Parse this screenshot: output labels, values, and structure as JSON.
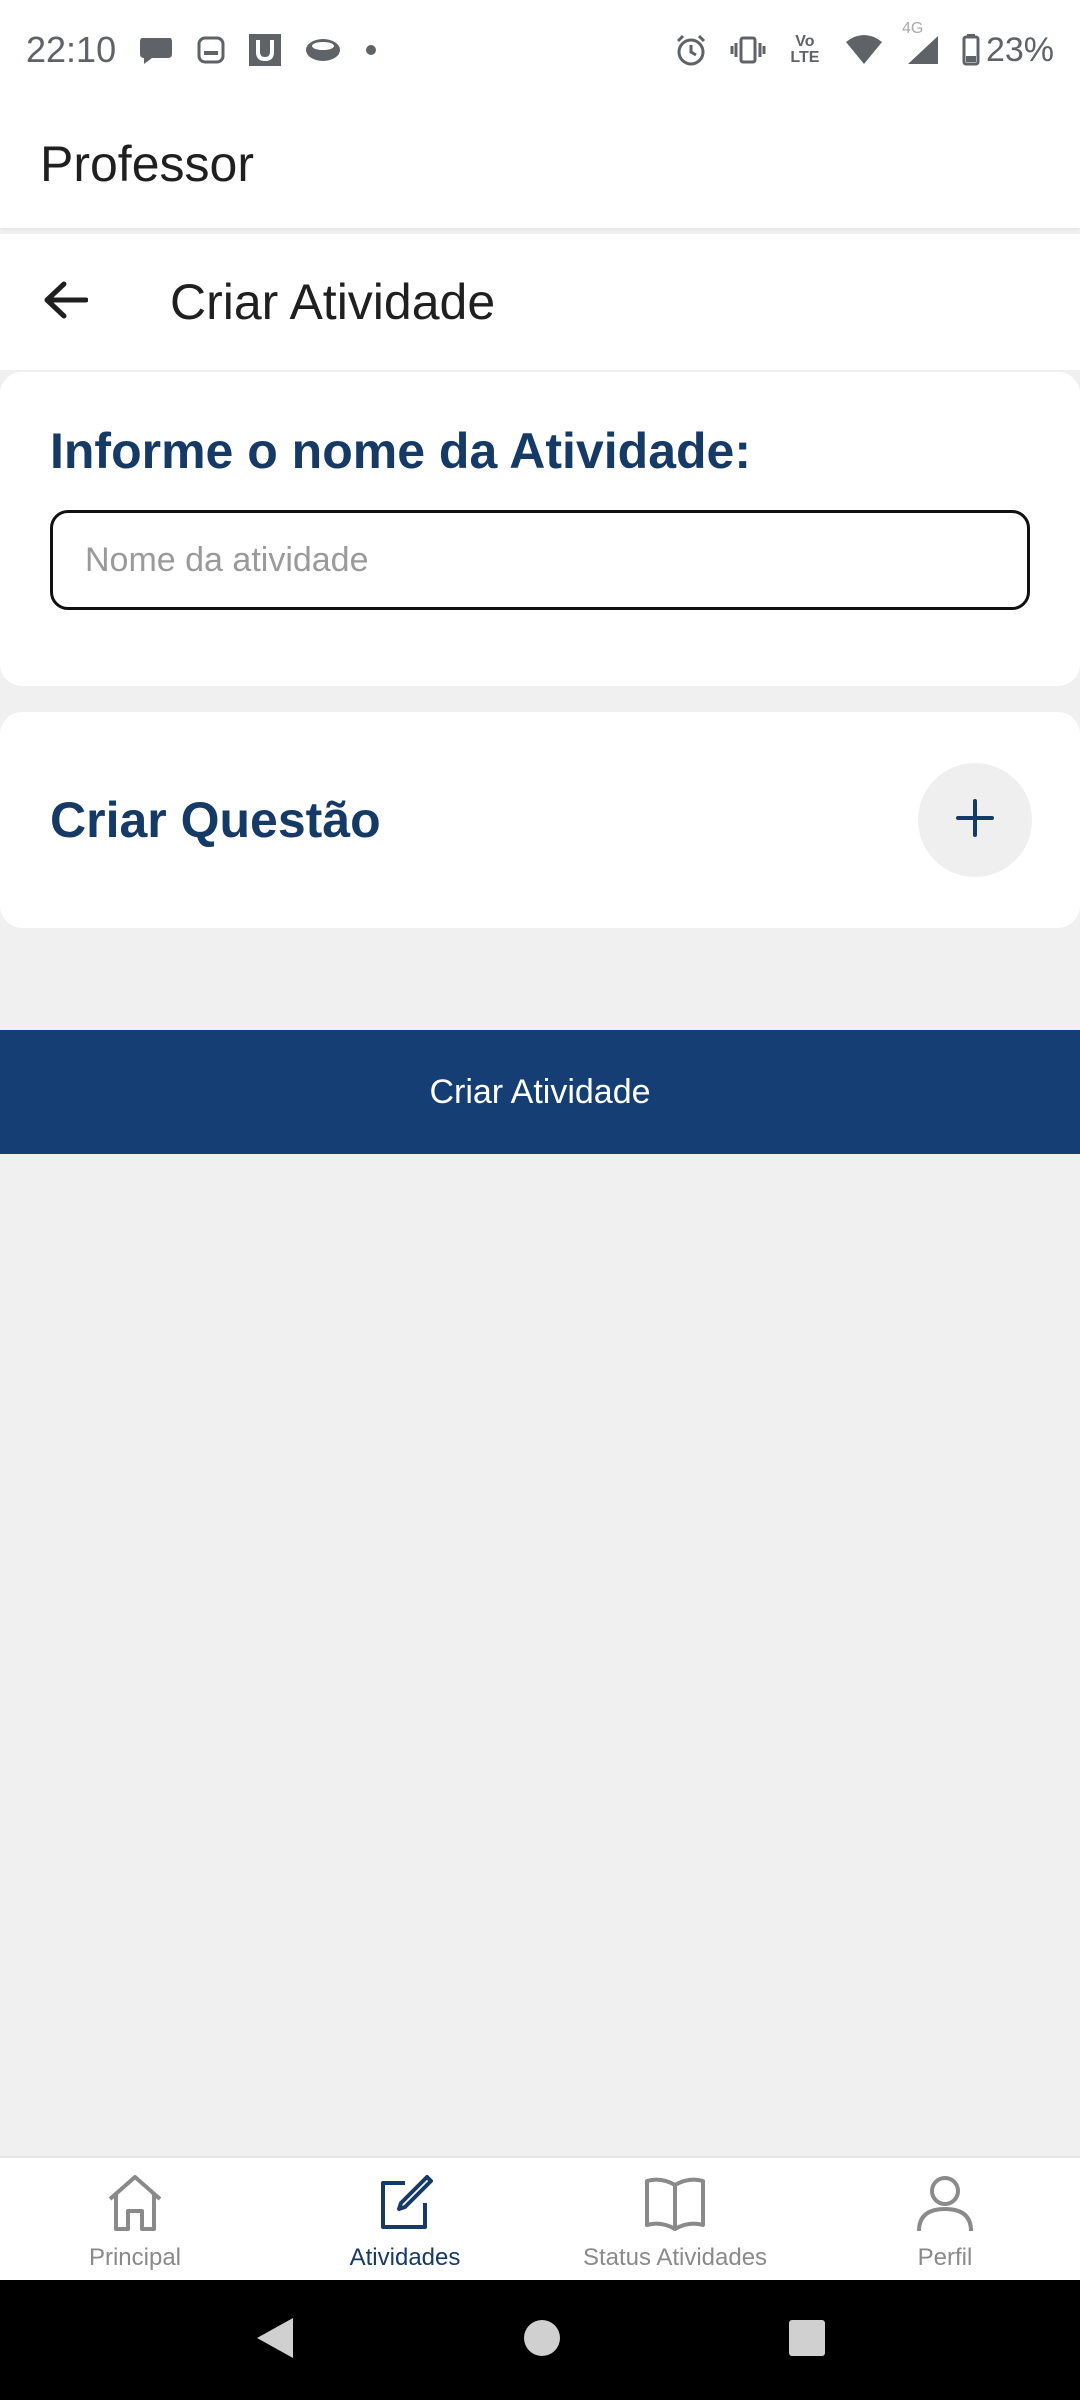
{
  "status_bar": {
    "time": "22:10",
    "left_icons": [
      "chat-bubble-icon",
      "message-square-icon",
      "u-app-icon",
      "eye-app-icon",
      "dot-icon"
    ],
    "right_icons": [
      "alarm-icon",
      "vibrate-icon",
      "volte-icon",
      "wifi-icon",
      "signal-4g-icon",
      "battery-icon"
    ],
    "volte_label": "Vo LTE",
    "network_label": "4G",
    "battery": "23%"
  },
  "app_bar": {
    "title": "Professor"
  },
  "sub_bar": {
    "title": "Criar Atividade",
    "back_icon": "arrow-left-icon"
  },
  "name_card": {
    "label": "Informe o nome da Atividade:",
    "input_placeholder": "Nome da atividade",
    "input_value": ""
  },
  "question_card": {
    "label": "Criar Questão",
    "add_icon": "plus-icon"
  },
  "primary_button": {
    "label": "Criar Atividade",
    "color": "#153f74"
  },
  "bottom_nav": {
    "items": [
      {
        "label": "Principal",
        "icon": "home-icon",
        "active": false
      },
      {
        "label": "Atividades",
        "icon": "edit-icon",
        "active": true
      },
      {
        "label": "Status Atividades",
        "icon": "book-icon",
        "active": false
      },
      {
        "label": "Perfil",
        "icon": "user-icon",
        "active": false
      }
    ]
  },
  "colors": {
    "accent": "#163a66",
    "button": "#153f74",
    "background": "#f0f0f0"
  }
}
